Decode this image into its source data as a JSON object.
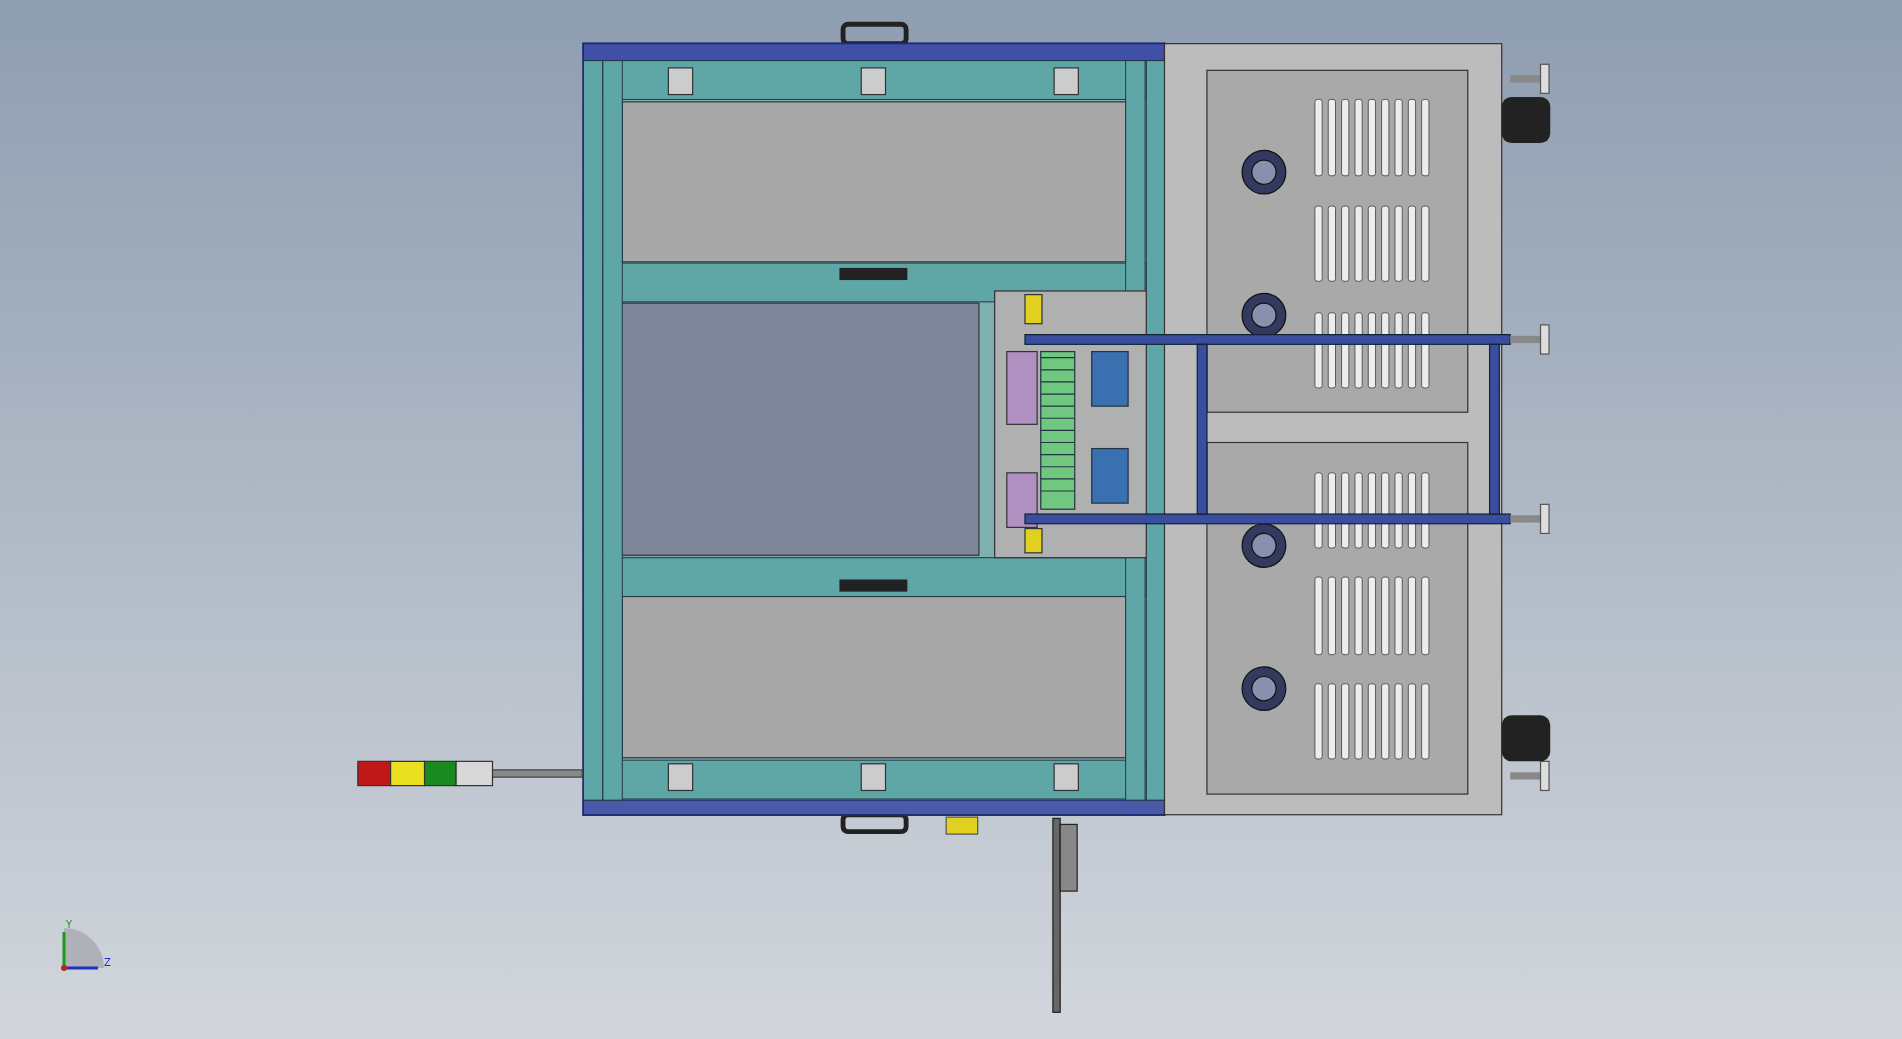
{
  "viewport": {
    "triad": {
      "axes": [
        {
          "label": "Y"
        },
        {
          "label": "Z"
        }
      ]
    }
  }
}
